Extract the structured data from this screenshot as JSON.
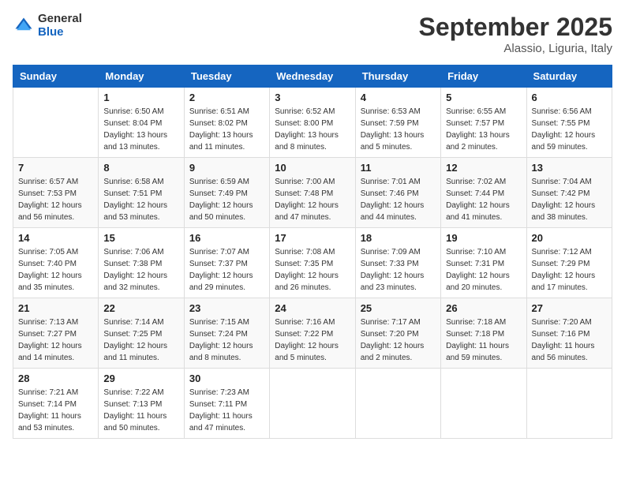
{
  "header": {
    "logo_general": "General",
    "logo_blue": "Blue",
    "month_title": "September 2025",
    "location": "Alassio, Liguria, Italy"
  },
  "weekdays": [
    "Sunday",
    "Monday",
    "Tuesday",
    "Wednesday",
    "Thursday",
    "Friday",
    "Saturday"
  ],
  "weeks": [
    [
      {
        "day": "",
        "sunrise": "",
        "sunset": "",
        "daylight": ""
      },
      {
        "day": "1",
        "sunrise": "Sunrise: 6:50 AM",
        "sunset": "Sunset: 8:04 PM",
        "daylight": "Daylight: 13 hours and 13 minutes."
      },
      {
        "day": "2",
        "sunrise": "Sunrise: 6:51 AM",
        "sunset": "Sunset: 8:02 PM",
        "daylight": "Daylight: 13 hours and 11 minutes."
      },
      {
        "day": "3",
        "sunrise": "Sunrise: 6:52 AM",
        "sunset": "Sunset: 8:00 PM",
        "daylight": "Daylight: 13 hours and 8 minutes."
      },
      {
        "day": "4",
        "sunrise": "Sunrise: 6:53 AM",
        "sunset": "Sunset: 7:59 PM",
        "daylight": "Daylight: 13 hours and 5 minutes."
      },
      {
        "day": "5",
        "sunrise": "Sunrise: 6:55 AM",
        "sunset": "Sunset: 7:57 PM",
        "daylight": "Daylight: 13 hours and 2 minutes."
      },
      {
        "day": "6",
        "sunrise": "Sunrise: 6:56 AM",
        "sunset": "Sunset: 7:55 PM",
        "daylight": "Daylight: 12 hours and 59 minutes."
      }
    ],
    [
      {
        "day": "7",
        "sunrise": "Sunrise: 6:57 AM",
        "sunset": "Sunset: 7:53 PM",
        "daylight": "Daylight: 12 hours and 56 minutes."
      },
      {
        "day": "8",
        "sunrise": "Sunrise: 6:58 AM",
        "sunset": "Sunset: 7:51 PM",
        "daylight": "Daylight: 12 hours and 53 minutes."
      },
      {
        "day": "9",
        "sunrise": "Sunrise: 6:59 AM",
        "sunset": "Sunset: 7:49 PM",
        "daylight": "Daylight: 12 hours and 50 minutes."
      },
      {
        "day": "10",
        "sunrise": "Sunrise: 7:00 AM",
        "sunset": "Sunset: 7:48 PM",
        "daylight": "Daylight: 12 hours and 47 minutes."
      },
      {
        "day": "11",
        "sunrise": "Sunrise: 7:01 AM",
        "sunset": "Sunset: 7:46 PM",
        "daylight": "Daylight: 12 hours and 44 minutes."
      },
      {
        "day": "12",
        "sunrise": "Sunrise: 7:02 AM",
        "sunset": "Sunset: 7:44 PM",
        "daylight": "Daylight: 12 hours and 41 minutes."
      },
      {
        "day": "13",
        "sunrise": "Sunrise: 7:04 AM",
        "sunset": "Sunset: 7:42 PM",
        "daylight": "Daylight: 12 hours and 38 minutes."
      }
    ],
    [
      {
        "day": "14",
        "sunrise": "Sunrise: 7:05 AM",
        "sunset": "Sunset: 7:40 PM",
        "daylight": "Daylight: 12 hours and 35 minutes."
      },
      {
        "day": "15",
        "sunrise": "Sunrise: 7:06 AM",
        "sunset": "Sunset: 7:38 PM",
        "daylight": "Daylight: 12 hours and 32 minutes."
      },
      {
        "day": "16",
        "sunrise": "Sunrise: 7:07 AM",
        "sunset": "Sunset: 7:37 PM",
        "daylight": "Daylight: 12 hours and 29 minutes."
      },
      {
        "day": "17",
        "sunrise": "Sunrise: 7:08 AM",
        "sunset": "Sunset: 7:35 PM",
        "daylight": "Daylight: 12 hours and 26 minutes."
      },
      {
        "day": "18",
        "sunrise": "Sunrise: 7:09 AM",
        "sunset": "Sunset: 7:33 PM",
        "daylight": "Daylight: 12 hours and 23 minutes."
      },
      {
        "day": "19",
        "sunrise": "Sunrise: 7:10 AM",
        "sunset": "Sunset: 7:31 PM",
        "daylight": "Daylight: 12 hours and 20 minutes."
      },
      {
        "day": "20",
        "sunrise": "Sunrise: 7:12 AM",
        "sunset": "Sunset: 7:29 PM",
        "daylight": "Daylight: 12 hours and 17 minutes."
      }
    ],
    [
      {
        "day": "21",
        "sunrise": "Sunrise: 7:13 AM",
        "sunset": "Sunset: 7:27 PM",
        "daylight": "Daylight: 12 hours and 14 minutes."
      },
      {
        "day": "22",
        "sunrise": "Sunrise: 7:14 AM",
        "sunset": "Sunset: 7:25 PM",
        "daylight": "Daylight: 12 hours and 11 minutes."
      },
      {
        "day": "23",
        "sunrise": "Sunrise: 7:15 AM",
        "sunset": "Sunset: 7:24 PM",
        "daylight": "Daylight: 12 hours and 8 minutes."
      },
      {
        "day": "24",
        "sunrise": "Sunrise: 7:16 AM",
        "sunset": "Sunset: 7:22 PM",
        "daylight": "Daylight: 12 hours and 5 minutes."
      },
      {
        "day": "25",
        "sunrise": "Sunrise: 7:17 AM",
        "sunset": "Sunset: 7:20 PM",
        "daylight": "Daylight: 12 hours and 2 minutes."
      },
      {
        "day": "26",
        "sunrise": "Sunrise: 7:18 AM",
        "sunset": "Sunset: 7:18 PM",
        "daylight": "Daylight: 11 hours and 59 minutes."
      },
      {
        "day": "27",
        "sunrise": "Sunrise: 7:20 AM",
        "sunset": "Sunset: 7:16 PM",
        "daylight": "Daylight: 11 hours and 56 minutes."
      }
    ],
    [
      {
        "day": "28",
        "sunrise": "Sunrise: 7:21 AM",
        "sunset": "Sunset: 7:14 PM",
        "daylight": "Daylight: 11 hours and 53 minutes."
      },
      {
        "day": "29",
        "sunrise": "Sunrise: 7:22 AM",
        "sunset": "Sunset: 7:13 PM",
        "daylight": "Daylight: 11 hours and 50 minutes."
      },
      {
        "day": "30",
        "sunrise": "Sunrise: 7:23 AM",
        "sunset": "Sunset: 7:11 PM",
        "daylight": "Daylight: 11 hours and 47 minutes."
      },
      {
        "day": "",
        "sunrise": "",
        "sunset": "",
        "daylight": ""
      },
      {
        "day": "",
        "sunrise": "",
        "sunset": "",
        "daylight": ""
      },
      {
        "day": "",
        "sunrise": "",
        "sunset": "",
        "daylight": ""
      },
      {
        "day": "",
        "sunrise": "",
        "sunset": "",
        "daylight": ""
      }
    ]
  ]
}
